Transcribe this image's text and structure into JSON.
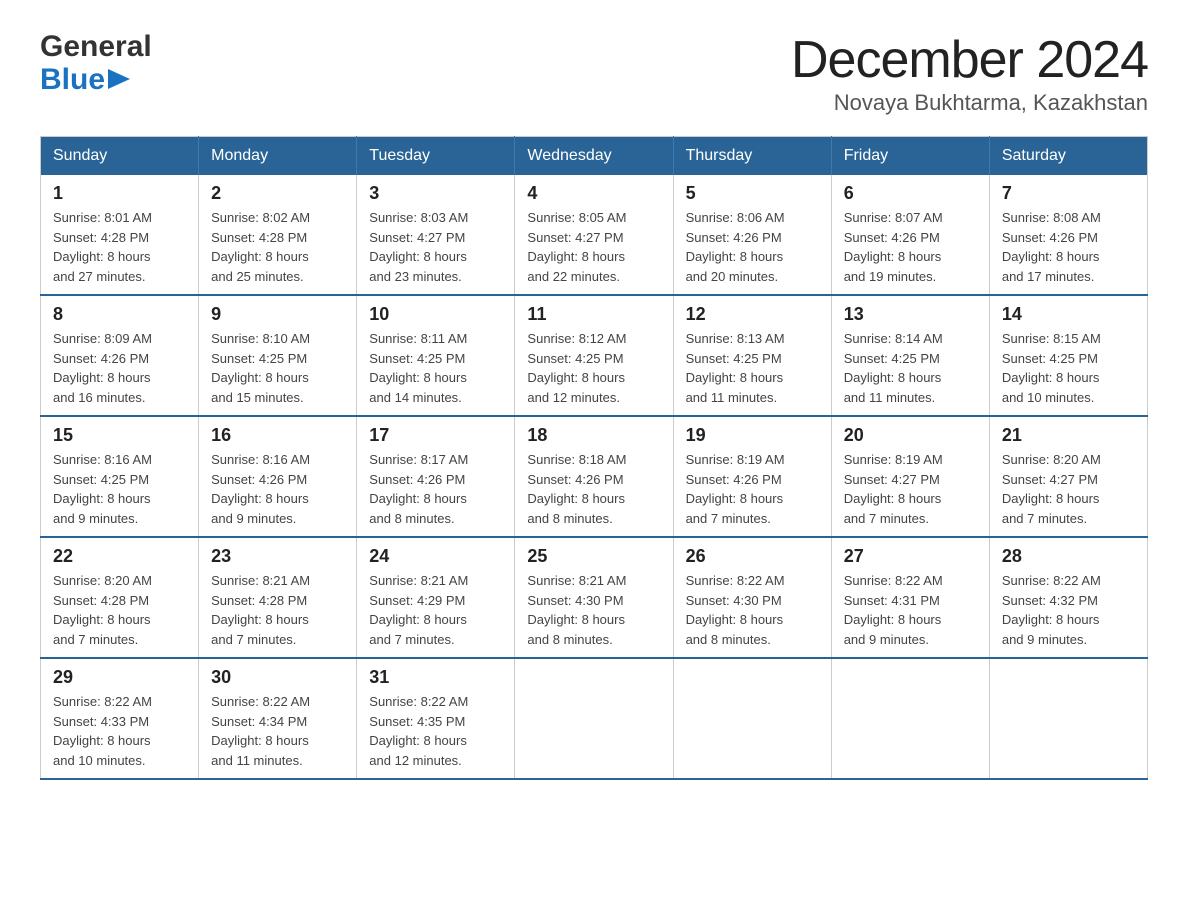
{
  "header": {
    "logo_line1": "General",
    "logo_line2": "Blue",
    "month_title": "December 2024",
    "location": "Novaya Bukhtarma, Kazakhstan"
  },
  "weekdays": [
    "Sunday",
    "Monday",
    "Tuesday",
    "Wednesday",
    "Thursday",
    "Friday",
    "Saturday"
  ],
  "weeks": [
    [
      {
        "day": "1",
        "info": "Sunrise: 8:01 AM\nSunset: 4:28 PM\nDaylight: 8 hours\nand 27 minutes."
      },
      {
        "day": "2",
        "info": "Sunrise: 8:02 AM\nSunset: 4:28 PM\nDaylight: 8 hours\nand 25 minutes."
      },
      {
        "day": "3",
        "info": "Sunrise: 8:03 AM\nSunset: 4:27 PM\nDaylight: 8 hours\nand 23 minutes."
      },
      {
        "day": "4",
        "info": "Sunrise: 8:05 AM\nSunset: 4:27 PM\nDaylight: 8 hours\nand 22 minutes."
      },
      {
        "day": "5",
        "info": "Sunrise: 8:06 AM\nSunset: 4:26 PM\nDaylight: 8 hours\nand 20 minutes."
      },
      {
        "day": "6",
        "info": "Sunrise: 8:07 AM\nSunset: 4:26 PM\nDaylight: 8 hours\nand 19 minutes."
      },
      {
        "day": "7",
        "info": "Sunrise: 8:08 AM\nSunset: 4:26 PM\nDaylight: 8 hours\nand 17 minutes."
      }
    ],
    [
      {
        "day": "8",
        "info": "Sunrise: 8:09 AM\nSunset: 4:26 PM\nDaylight: 8 hours\nand 16 minutes."
      },
      {
        "day": "9",
        "info": "Sunrise: 8:10 AM\nSunset: 4:25 PM\nDaylight: 8 hours\nand 15 minutes."
      },
      {
        "day": "10",
        "info": "Sunrise: 8:11 AM\nSunset: 4:25 PM\nDaylight: 8 hours\nand 14 minutes."
      },
      {
        "day": "11",
        "info": "Sunrise: 8:12 AM\nSunset: 4:25 PM\nDaylight: 8 hours\nand 12 minutes."
      },
      {
        "day": "12",
        "info": "Sunrise: 8:13 AM\nSunset: 4:25 PM\nDaylight: 8 hours\nand 11 minutes."
      },
      {
        "day": "13",
        "info": "Sunrise: 8:14 AM\nSunset: 4:25 PM\nDaylight: 8 hours\nand 11 minutes."
      },
      {
        "day": "14",
        "info": "Sunrise: 8:15 AM\nSunset: 4:25 PM\nDaylight: 8 hours\nand 10 minutes."
      }
    ],
    [
      {
        "day": "15",
        "info": "Sunrise: 8:16 AM\nSunset: 4:25 PM\nDaylight: 8 hours\nand 9 minutes."
      },
      {
        "day": "16",
        "info": "Sunrise: 8:16 AM\nSunset: 4:26 PM\nDaylight: 8 hours\nand 9 minutes."
      },
      {
        "day": "17",
        "info": "Sunrise: 8:17 AM\nSunset: 4:26 PM\nDaylight: 8 hours\nand 8 minutes."
      },
      {
        "day": "18",
        "info": "Sunrise: 8:18 AM\nSunset: 4:26 PM\nDaylight: 8 hours\nand 8 minutes."
      },
      {
        "day": "19",
        "info": "Sunrise: 8:19 AM\nSunset: 4:26 PM\nDaylight: 8 hours\nand 7 minutes."
      },
      {
        "day": "20",
        "info": "Sunrise: 8:19 AM\nSunset: 4:27 PM\nDaylight: 8 hours\nand 7 minutes."
      },
      {
        "day": "21",
        "info": "Sunrise: 8:20 AM\nSunset: 4:27 PM\nDaylight: 8 hours\nand 7 minutes."
      }
    ],
    [
      {
        "day": "22",
        "info": "Sunrise: 8:20 AM\nSunset: 4:28 PM\nDaylight: 8 hours\nand 7 minutes."
      },
      {
        "day": "23",
        "info": "Sunrise: 8:21 AM\nSunset: 4:28 PM\nDaylight: 8 hours\nand 7 minutes."
      },
      {
        "day": "24",
        "info": "Sunrise: 8:21 AM\nSunset: 4:29 PM\nDaylight: 8 hours\nand 7 minutes."
      },
      {
        "day": "25",
        "info": "Sunrise: 8:21 AM\nSunset: 4:30 PM\nDaylight: 8 hours\nand 8 minutes."
      },
      {
        "day": "26",
        "info": "Sunrise: 8:22 AM\nSunset: 4:30 PM\nDaylight: 8 hours\nand 8 minutes."
      },
      {
        "day": "27",
        "info": "Sunrise: 8:22 AM\nSunset: 4:31 PM\nDaylight: 8 hours\nand 9 minutes."
      },
      {
        "day": "28",
        "info": "Sunrise: 8:22 AM\nSunset: 4:32 PM\nDaylight: 8 hours\nand 9 minutes."
      }
    ],
    [
      {
        "day": "29",
        "info": "Sunrise: 8:22 AM\nSunset: 4:33 PM\nDaylight: 8 hours\nand 10 minutes."
      },
      {
        "day": "30",
        "info": "Sunrise: 8:22 AM\nSunset: 4:34 PM\nDaylight: 8 hours\nand 11 minutes."
      },
      {
        "day": "31",
        "info": "Sunrise: 8:22 AM\nSunset: 4:35 PM\nDaylight: 8 hours\nand 12 minutes."
      },
      null,
      null,
      null,
      null
    ]
  ]
}
